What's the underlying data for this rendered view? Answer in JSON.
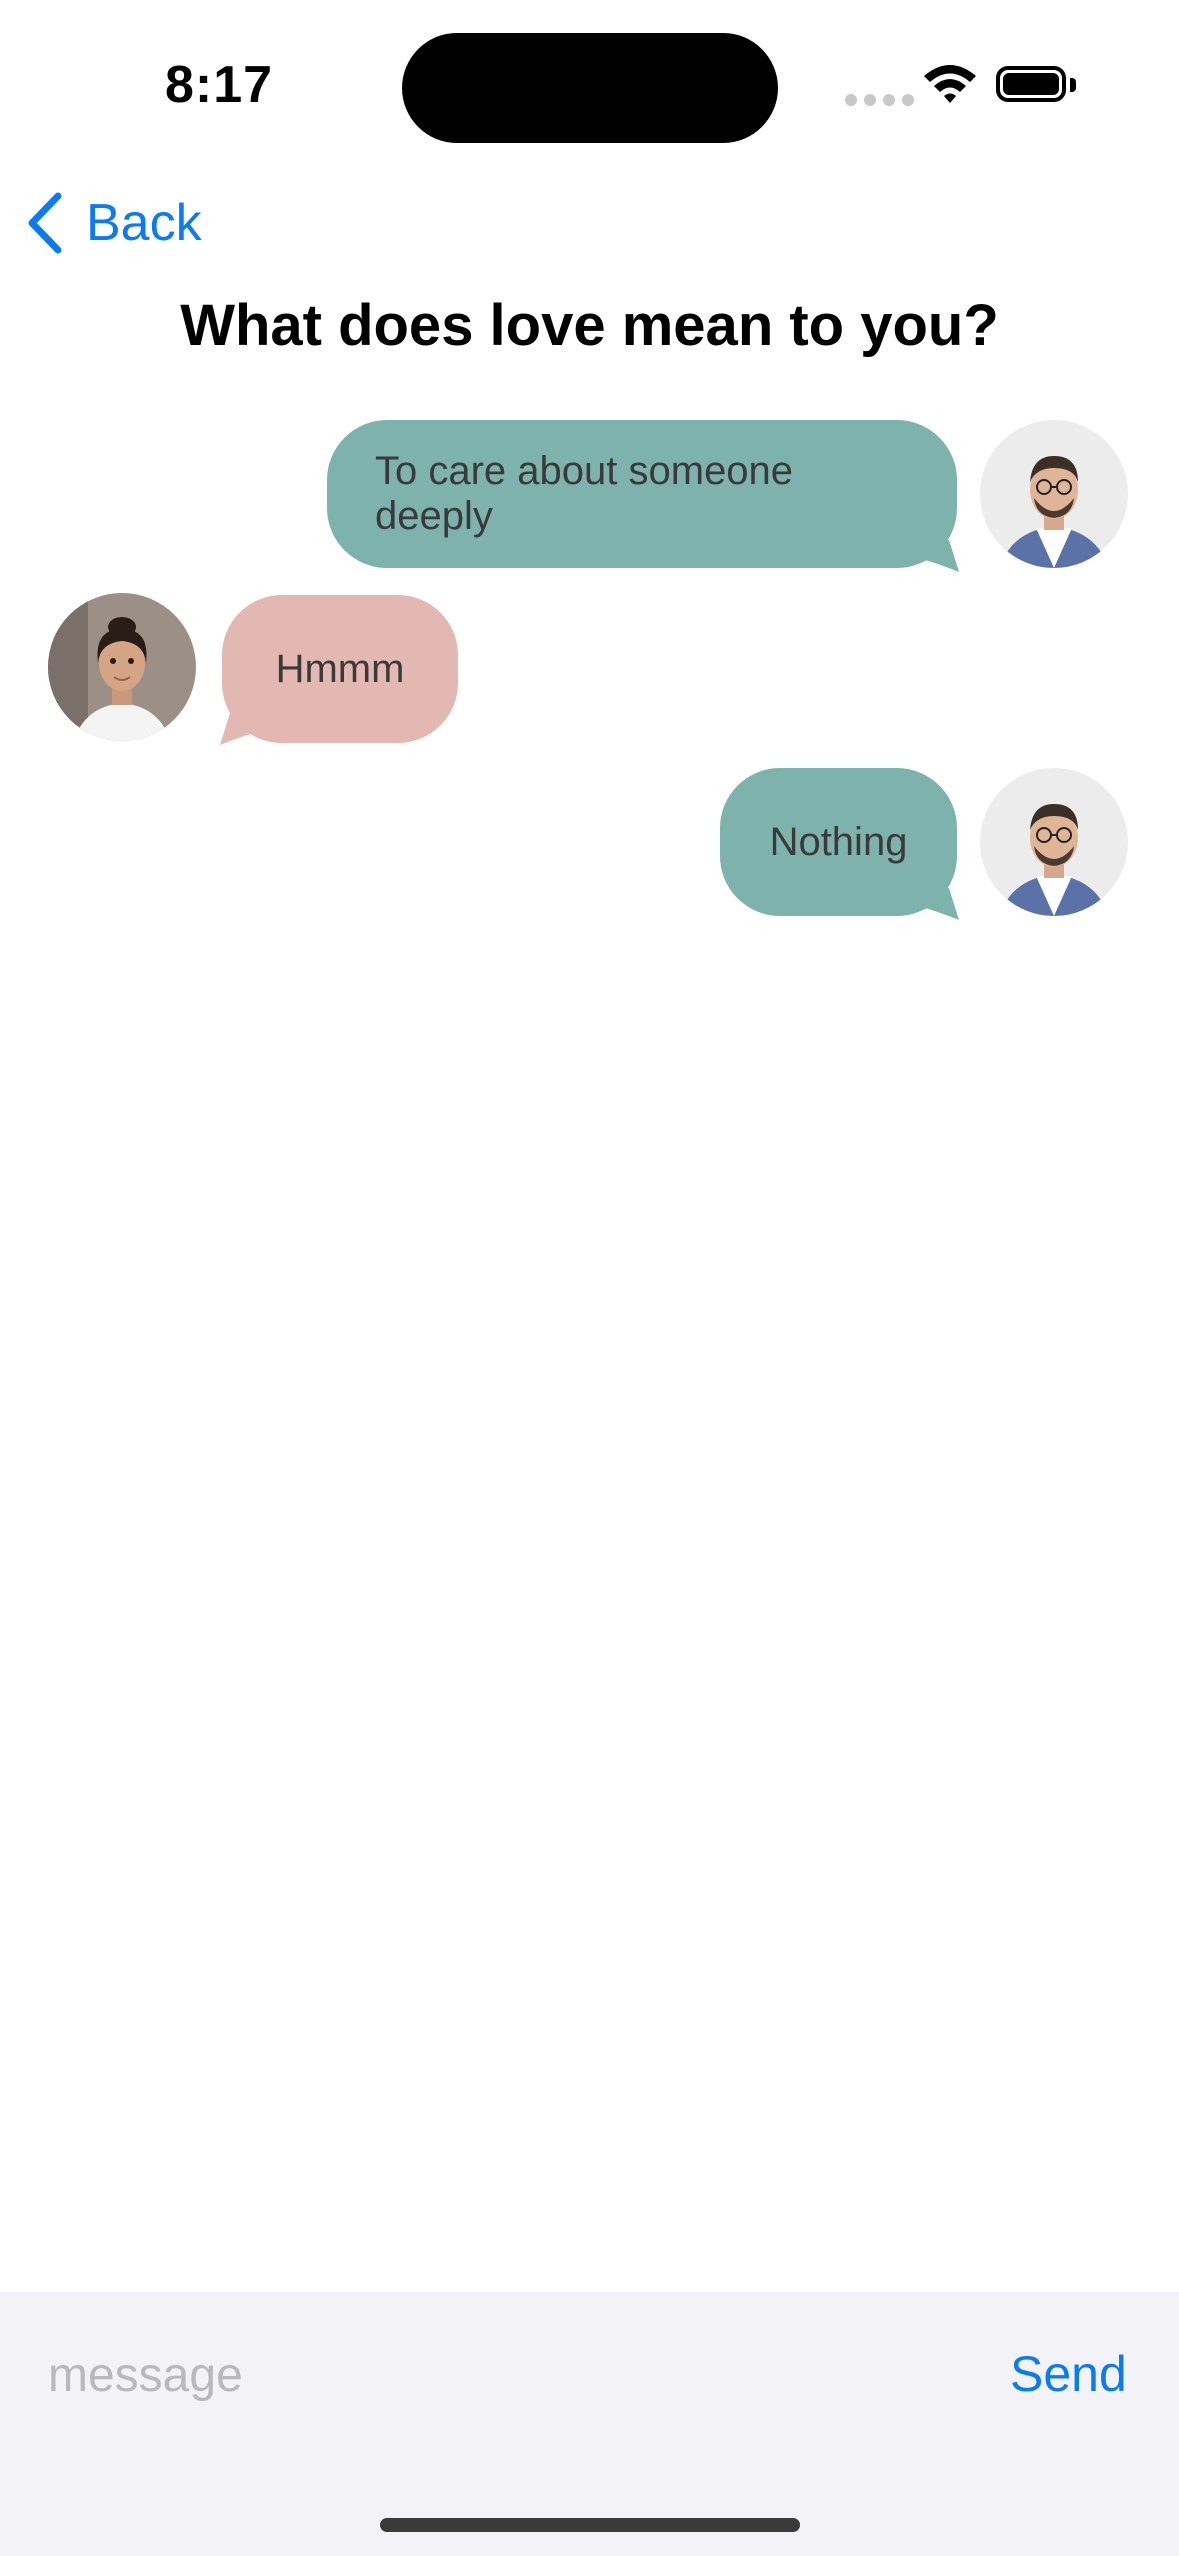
{
  "status_bar": {
    "time": "8:17"
  },
  "nav": {
    "back_label": "Back",
    "title": "What does love mean to you?"
  },
  "messages": [
    {
      "text": "To care about someone deeply",
      "direction": "outgoing",
      "sender": "man"
    },
    {
      "text": "Hmmm",
      "direction": "incoming",
      "sender": "woman"
    },
    {
      "text": "Nothing",
      "direction": "outgoing",
      "sender": "man"
    }
  ],
  "composer": {
    "placeholder": "message",
    "value": "",
    "send_label": "Send"
  },
  "colors": {
    "accent": "#0a7cf0",
    "outgoing_bubble": "#7db3ac",
    "incoming_bubble": "#e3b8b2",
    "composer_bg": "#f2f2f7"
  }
}
